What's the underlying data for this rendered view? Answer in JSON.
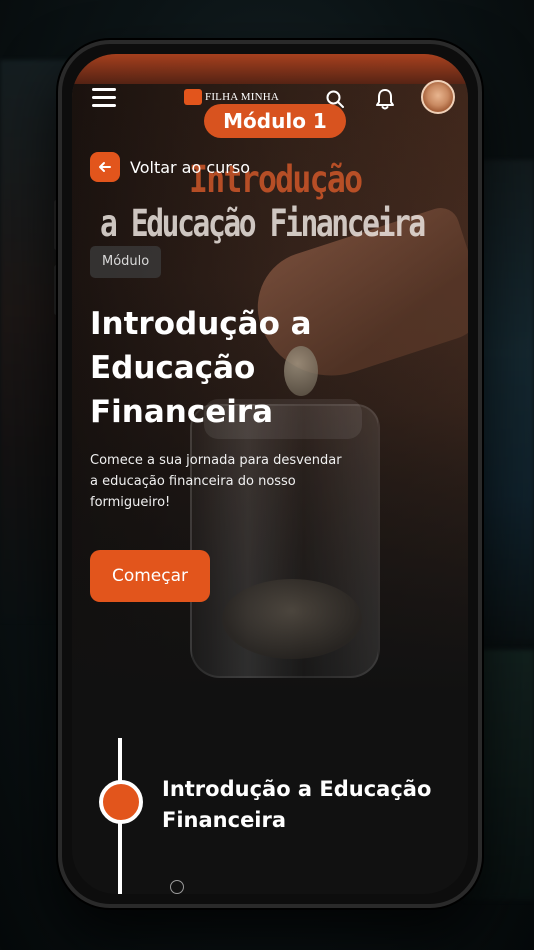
{
  "topbar": {
    "logo_text": "FILHA MINHA",
    "menu_icon": "hamburger-menu-icon",
    "search_icon": "search-icon",
    "bell_icon": "bell-icon",
    "avatar": "user-avatar"
  },
  "banner": {
    "module_pill": "Módulo 1",
    "title_line1": "Introdução",
    "title_line2": "a Educação Financeira"
  },
  "back": {
    "label": "Voltar ao curso"
  },
  "tag": "Módulo",
  "module": {
    "title": "Introdução a Educação Financeira",
    "description": "Comece a sua jornada para desvendar a educação financeira do nosso formigueiro!",
    "cta": "Começar"
  },
  "timeline": [
    {
      "title": "Introdução a Educação Financeira"
    }
  ],
  "colors": {
    "accent": "#e2551c",
    "background": "#111111",
    "text": "#ffffff"
  }
}
